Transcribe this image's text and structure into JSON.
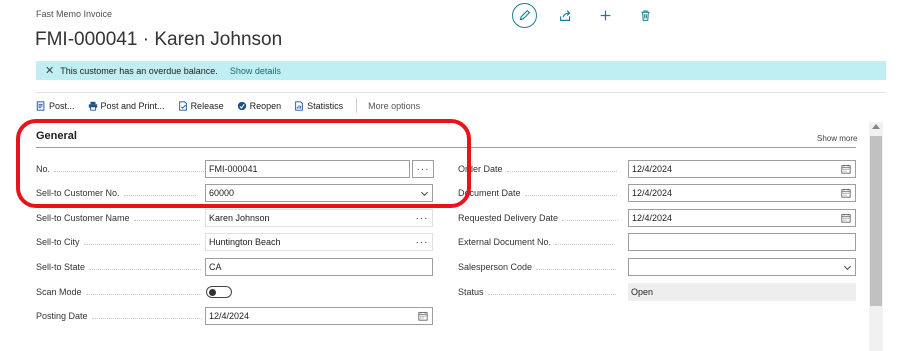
{
  "breadcrumb": "Fast Memo Invoice",
  "title": "FMI-000041 · Karen Johnson",
  "top_actions": [
    {
      "name": "edit-icon"
    },
    {
      "name": "share-icon"
    },
    {
      "name": "add-icon"
    },
    {
      "name": "delete-icon"
    }
  ],
  "banner": {
    "message": "This customer has an overdue balance.",
    "link": "Show details",
    "color": "#bfeff2"
  },
  "toolbar": {
    "post": "Post...",
    "post_print": "Post and Print...",
    "release": "Release",
    "reopen": "Reopen",
    "statistics": "Statistics",
    "more": "More options"
  },
  "section": {
    "title": "General",
    "show_more": "Show more"
  },
  "left_fields": {
    "no": {
      "label": "No.",
      "value": "FMI-000041"
    },
    "customer_no": {
      "label": "Sell-to Customer No.",
      "value": "60000"
    },
    "customer_name": {
      "label": "Sell-to Customer Name",
      "value": "Karen Johnson"
    },
    "city": {
      "label": "Sell-to City",
      "value": "Huntington Beach"
    },
    "state": {
      "label": "Sell-to State",
      "value": "CA"
    },
    "scan_mode": {
      "label": "Scan Mode"
    },
    "posting_date": {
      "label": "Posting Date",
      "value": "12/4/2024"
    }
  },
  "right_fields": {
    "order_date": {
      "label": "Order Date",
      "value": "12/4/2024"
    },
    "document_date": {
      "label": "Document Date",
      "value": "12/4/2024"
    },
    "requested_delivery": {
      "label": "Requested Delivery Date",
      "value": "12/4/2024"
    },
    "external_doc": {
      "label": "External Document No.",
      "value": ""
    },
    "salesperson": {
      "label": "Salesperson Code",
      "value": ""
    },
    "status": {
      "label": "Status",
      "value": "Open"
    }
  },
  "colors": {
    "accent": "#1a7f8a",
    "highlight": "#e8141b"
  }
}
